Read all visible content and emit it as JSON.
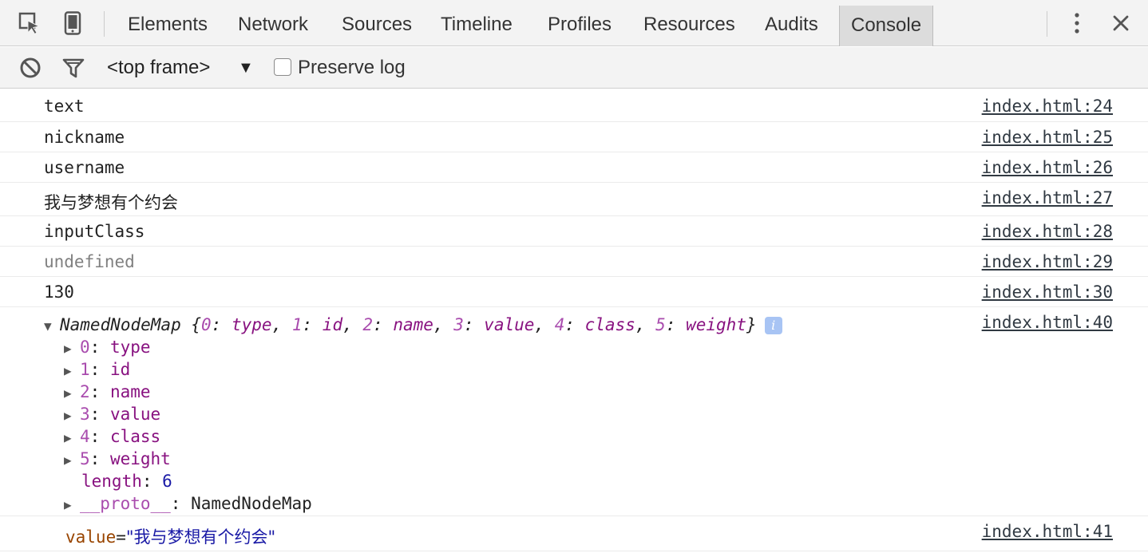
{
  "tabs": {
    "items": [
      {
        "label": "Elements",
        "left": 0
      },
      {
        "label": "Network"
      },
      {
        "label": "Sources"
      },
      {
        "label": "Timeline"
      },
      {
        "label": "Profiles"
      },
      {
        "label": "Resources"
      },
      {
        "label": "Audits"
      },
      {
        "label": "Console"
      }
    ],
    "active": "Console"
  },
  "toolbar": {
    "frame_label": "<top frame>",
    "frame_arrow": "▼",
    "preserve_log_label": "Preserve log",
    "preserve_log_checked": false
  },
  "messages": [
    {
      "text": "text",
      "source": "index.html:24"
    },
    {
      "text": "nickname",
      "source": "index.html:25"
    },
    {
      "text": "username",
      "source": "index.html:26"
    },
    {
      "text": "我与梦想有个约会",
      "source": "index.html:27"
    },
    {
      "text": "inputClass",
      "source": "index.html:28"
    },
    {
      "text": "undefined",
      "source": "index.html:29"
    },
    {
      "text": "130",
      "source": "index.html:30"
    }
  ],
  "object_message": {
    "source": "index.html:40",
    "class_name": "NamedNodeMap",
    "preview": [
      {
        "key": "0",
        "value": "type"
      },
      {
        "key": "1",
        "value": "id"
      },
      {
        "key": "2",
        "value": "name"
      },
      {
        "key": "3",
        "value": "value"
      },
      {
        "key": "4",
        "value": "class"
      },
      {
        "key": "5",
        "value": "weight"
      }
    ],
    "length_key": "length",
    "length_value": "6",
    "proto_key": "__proto__",
    "proto_value": "NamedNodeMap"
  },
  "attr_message": {
    "name": "value",
    "value": "\"我与梦想有个约会\"",
    "source": "index.html:41"
  }
}
